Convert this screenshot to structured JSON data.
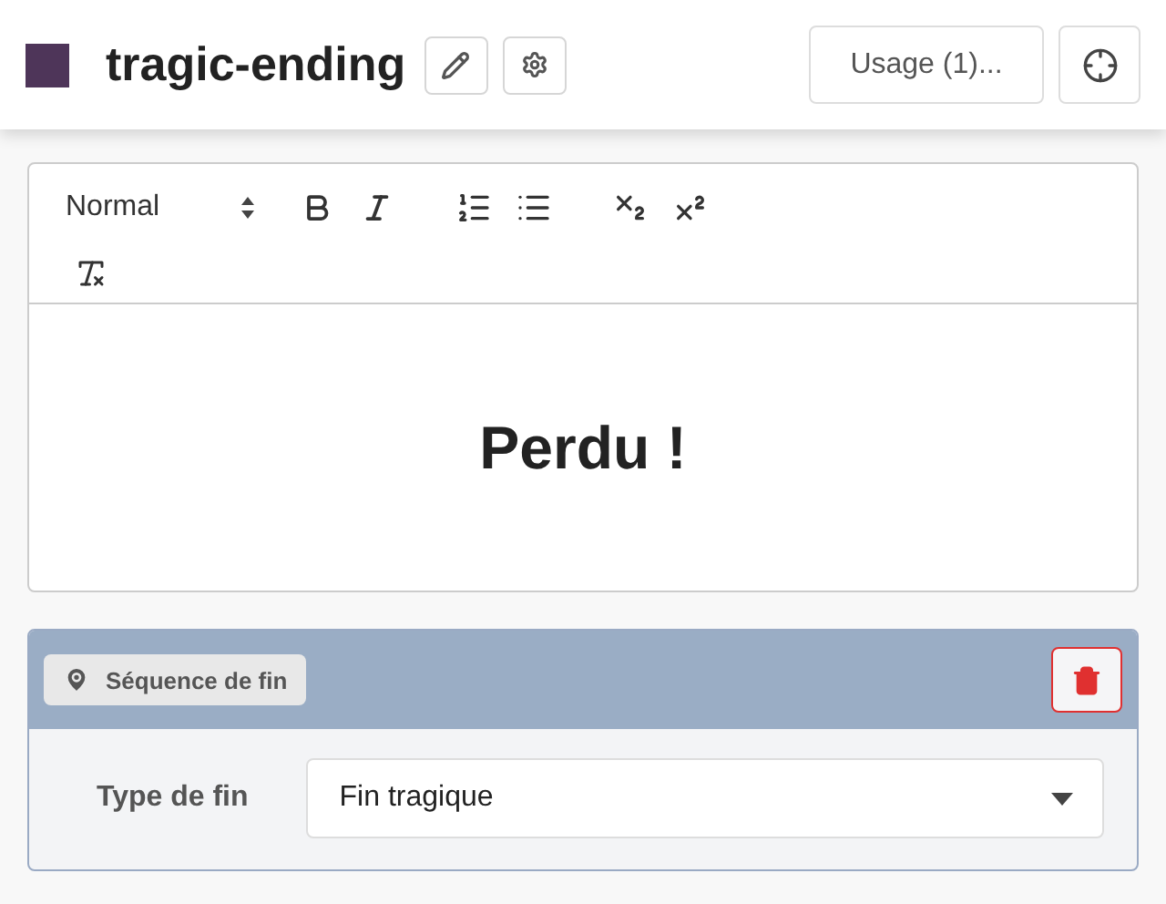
{
  "header": {
    "title": "tragic-ending",
    "color": "#4e3559",
    "usage_button": "Usage (1)..."
  },
  "editor": {
    "format_select": "Normal",
    "content": "Perdu !"
  },
  "component": {
    "tag": "Séquence de fin",
    "field_label": "Type de fin",
    "field_value": "Fin tragique"
  }
}
